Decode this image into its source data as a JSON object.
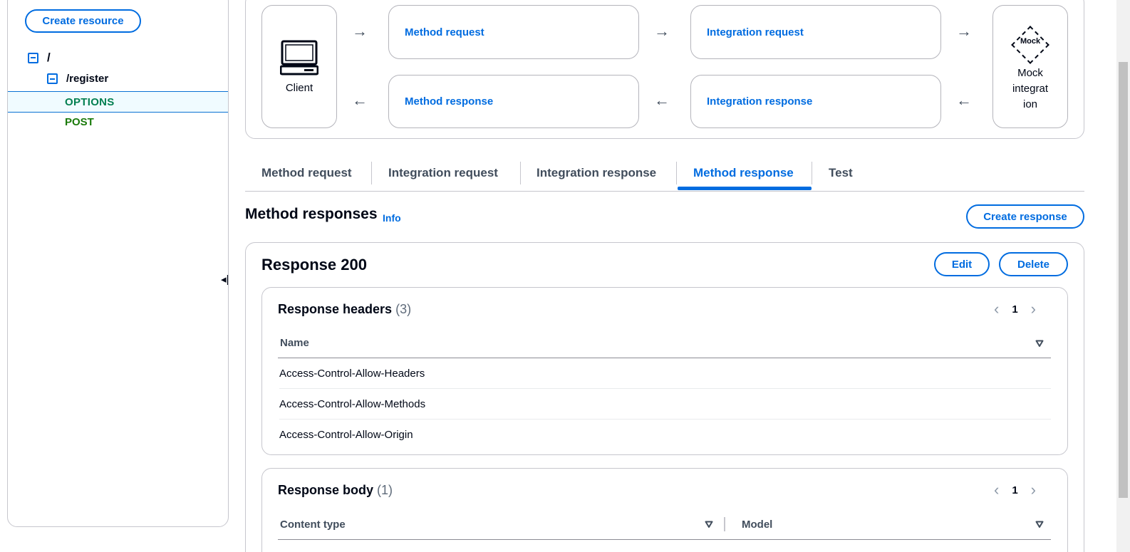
{
  "sidebar": {
    "create_resource_label": "Create resource",
    "tree": {
      "root": "/",
      "register": "/register",
      "methods": [
        "OPTIONS",
        "POST"
      ]
    },
    "drag_handle": "◂|"
  },
  "flow": {
    "client_label": "Client",
    "method_request": "Method request",
    "integration_request": "Integration request",
    "method_response": "Method response",
    "integration_response": "Integration response",
    "mock_badge": "Mock",
    "mock_label_lines": [
      "Mock",
      "integrat",
      "ion"
    ],
    "arrow_right": "→",
    "arrow_left": "←"
  },
  "tabs": [
    {
      "label": "Method request",
      "active": false
    },
    {
      "label": "Integration request",
      "active": false
    },
    {
      "label": "Integration response",
      "active": false
    },
    {
      "label": "Method response",
      "active": true
    },
    {
      "label": "Test",
      "active": false
    }
  ],
  "method_responses": {
    "title": "Method responses",
    "info": "Info",
    "create_response_label": "Create response",
    "response": {
      "title": "Response 200",
      "edit_label": "Edit",
      "delete_label": "Delete",
      "headers": {
        "title": "Response headers",
        "count": "(3)",
        "page": "1",
        "column": "Name",
        "rows": [
          "Access-Control-Allow-Headers",
          "Access-Control-Allow-Methods",
          "Access-Control-Allow-Origin"
        ]
      },
      "body": {
        "title": "Response body",
        "count": "(1)",
        "page": "1",
        "columns": [
          "Content type",
          "Model"
        ]
      }
    }
  },
  "colors": {
    "accent": "#006ce0",
    "options_method": "#037f51",
    "post_method": "#1a7a0a",
    "border": "#c6c6cd"
  }
}
